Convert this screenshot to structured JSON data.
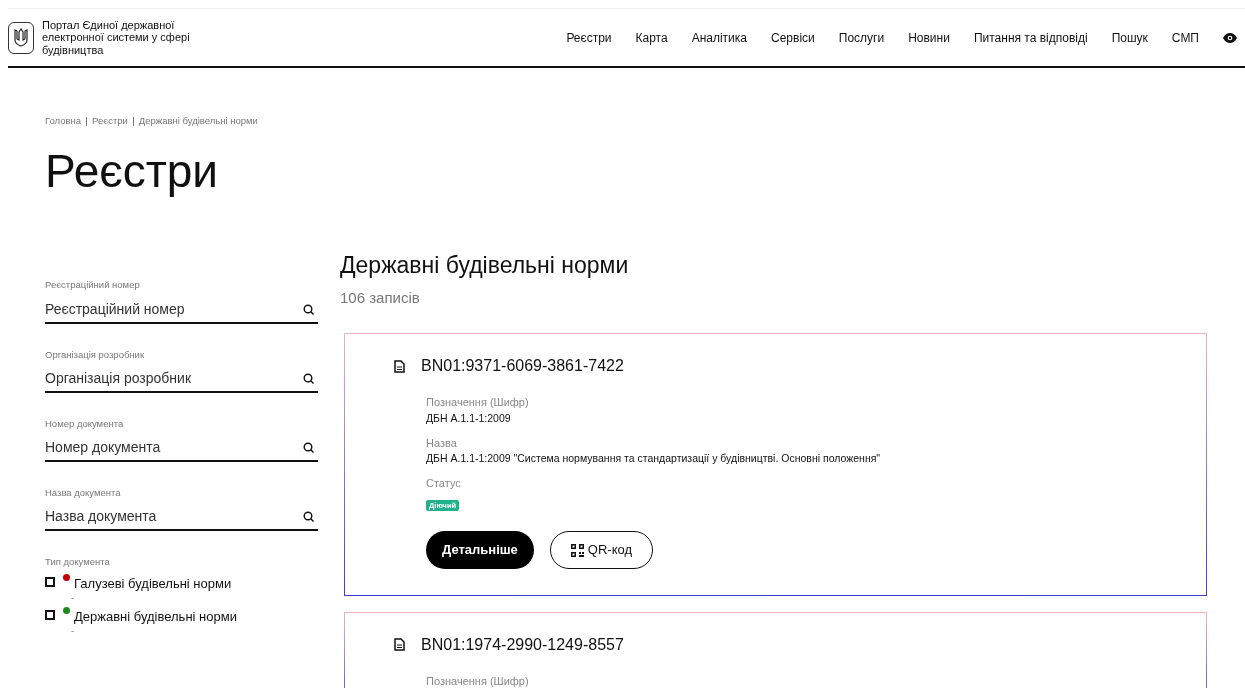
{
  "header": {
    "title": "Портал Єдиної державної електронної системи у сфері будівництва",
    "nav": [
      "Реєстри",
      "Карта",
      "Аналітика",
      "Сервіси",
      "Послуги",
      "Новини",
      "Питання та відповіді",
      "Пошук",
      "СМП"
    ]
  },
  "breadcrumbs": [
    "Головна",
    "Реєстри",
    "Державні будівельні норми"
  ],
  "page_title": "Реєстри",
  "filters": [
    {
      "label": "Реєстраційний номер",
      "placeholder": "Реєстраційний номер"
    },
    {
      "label": "Організація розробник",
      "placeholder": "Організація розробник"
    },
    {
      "label": "Номер документа",
      "placeholder": "Номер документа"
    },
    {
      "label": "Назва документа",
      "placeholder": "Назва документа"
    }
  ],
  "doc_types": {
    "label": "Тип документа",
    "options": [
      {
        "label": "Галузеві будівельні норми",
        "note": "-",
        "color": "#c00000",
        "checked": false
      },
      {
        "label": "Державні будівельні норми",
        "note": "-",
        "color": "#1e8a1e",
        "checked": false
      }
    ]
  },
  "section": {
    "title": "Державні будівельні норми",
    "count": "106 записів"
  },
  "records": [
    {
      "code": "BN01:9371-6069-3861-7422",
      "fields": [
        {
          "label": "Позначення (Шифр)",
          "value": "ДБН А.1.1-1:2009"
        },
        {
          "label": "Назва",
          "value": "ДБН А.1.1-1:2009 \"Система нормування та стандартизації у будівництві. Основні положення\""
        }
      ],
      "status": {
        "label": "Статус",
        "value": "Діючий"
      },
      "buttons": {
        "details": "Детальніше",
        "qr": "QR-код"
      }
    },
    {
      "code": "BN01:1974-2990-1249-8557",
      "fields": [
        {
          "label": "Позначення (Шифр)"
        }
      ]
    }
  ]
}
